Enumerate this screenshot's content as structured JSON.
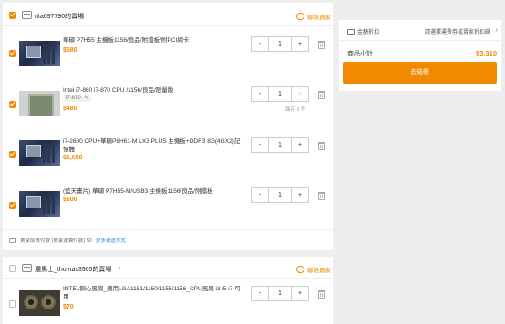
{
  "shops": [
    {
      "seller": "rita697790的賣場",
      "contact": "聯絡賣家",
      "items": [
        {
          "title": "華碩 P7H55 主機板1156/良品/附擋板/附PCI網卡",
          "price": "$580",
          "qty": "1"
        },
        {
          "title": "Intel i7-860 i7-870 CPU /1156/良品/限量版",
          "spec": "i7-870",
          "price": "$480",
          "qty": "1",
          "stock": "庫存 1 件"
        },
        {
          "title": "i7-2600 CPU+華碩P8H61-M LX3 PLUS 主機板+DDR3 8G(4GX2)記憶體",
          "price": "$1,650",
          "qty": "1"
        },
        {
          "title": "(藍天畫片) 華碩 P7H55-M/USB3 主機板1156/良品/附擋板",
          "price": "$600",
          "qty": "1"
        }
      ],
      "shipping": "賣家取貨付款 (賣家運費付款) $0",
      "shipping_more": "更多運送方式"
    },
    {
      "seller": "濃馬士_thomas3905的賣場",
      "contact": "聯絡賣家",
      "items": [
        {
          "title": "INTEL銅心風扇_適用LGA1151/1150/1155/1156_CPU風扇 i3 i5 i7 可用",
          "price": "$70",
          "qty": "1"
        }
      ]
    }
  ],
  "summary": {
    "coupon_label": "金額折扣",
    "coupon_hint": "請選擇運費券或賣家折扣碼",
    "subtotal_label": "商品小計",
    "subtotal_value": "$3,310",
    "checkout_label": "去結帳"
  },
  "colors": {
    "accent": "#f18a00",
    "link": "#2b7bd0"
  }
}
